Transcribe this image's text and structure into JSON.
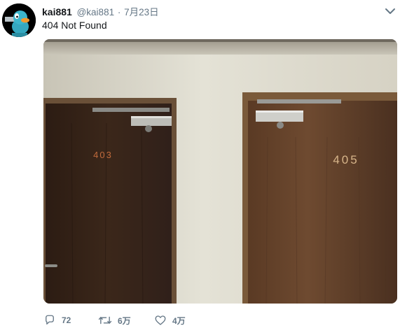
{
  "user": {
    "display_name": "kai881",
    "handle": "@kai881",
    "separator": "·",
    "date": "7月23日"
  },
  "tweet": {
    "text": "404 Not Found"
  },
  "photo": {
    "door_left_number": "403",
    "door_right_number": "405"
  },
  "actions": {
    "reply_count": "72",
    "retweet_count": "6万",
    "like_count": "4万"
  },
  "colors": {
    "text": "#14171a",
    "secondary": "#657786",
    "avatar_character": "#35a8c0"
  },
  "icons": [
    "avatar",
    "chevron-down-icon",
    "reply-icon",
    "retweet-icon",
    "heart-icon"
  ]
}
